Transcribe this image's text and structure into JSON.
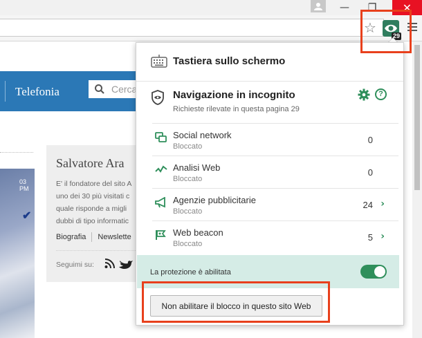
{
  "browser": {
    "window": {
      "minimize": "—",
      "maximize": "❐",
      "close": "✕"
    },
    "star_glyph": "☆",
    "extension": {
      "badge": "29",
      "icon": "eye-icon",
      "color": "#2f7d5e"
    }
  },
  "site": {
    "nav_link": "Telefonia",
    "search_placeholder": "Cerca",
    "photo_text": "03 PM",
    "author": {
      "name": "Salvatore Ara",
      "bio": [
        "E' il fondatore del sito A",
        "uno dei 30 più visitati c",
        "quale risponde a migli",
        "dubbi di tipo informatic"
      ],
      "links": [
        "Biografia",
        "Newslette"
      ],
      "follow": "Seguimi su:"
    }
  },
  "popup": {
    "keyboard_title": "Tastiera sullo schermo",
    "incognito": {
      "title": "Navigazione in incognito",
      "subtitle": "Richieste rilevate in questa pagina",
      "count": "29"
    },
    "categories": [
      {
        "name": "Social network",
        "status": "Bloccato",
        "count": "0",
        "has_arrow": false,
        "icon": "social-network-icon"
      },
      {
        "name": "Analisi Web",
        "status": "Bloccato",
        "count": "0",
        "has_arrow": false,
        "icon": "web-analytics-icon"
      },
      {
        "name": "Agenzie pubblicitarie",
        "status": "Bloccato",
        "count": "24",
        "has_arrow": true,
        "icon": "megaphone-icon"
      },
      {
        "name": "Web beacon",
        "status": "Bloccato",
        "count": "5",
        "has_arrow": true,
        "icon": "beacon-flag-icon"
      }
    ],
    "chevron": "›",
    "protection_label": "La protezione è abilitata",
    "protection_enabled": true,
    "disable_button": "Non abilitare il blocco in questo sito Web",
    "accent_color": "#2f8f5b",
    "highlight_color": "#e8401c"
  }
}
